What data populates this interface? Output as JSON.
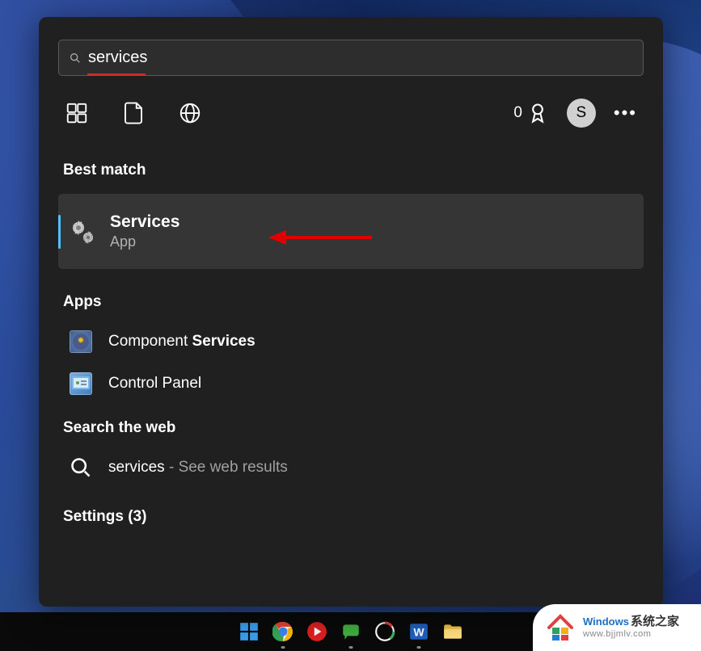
{
  "search": {
    "value": "services"
  },
  "rewards": {
    "count": "0"
  },
  "avatar": {
    "initial": "S"
  },
  "sections": {
    "best_match": "Best match",
    "apps": "Apps",
    "web": "Search the web",
    "settings": "Settings (3)"
  },
  "best_match": {
    "title": "Services",
    "subtitle": "App"
  },
  "apps": [
    {
      "prefix": "Component ",
      "bold": "Services",
      "icon": "mmc-icon"
    },
    {
      "prefix": "Control Panel",
      "bold": "",
      "icon": "cp-icon"
    }
  ],
  "web": {
    "query": "services",
    "suffix": " - See web results"
  },
  "watermark": {
    "brand_win": "Windows",
    "brand_sys": "系统之家",
    "url": "www.bjjmlv.com"
  }
}
